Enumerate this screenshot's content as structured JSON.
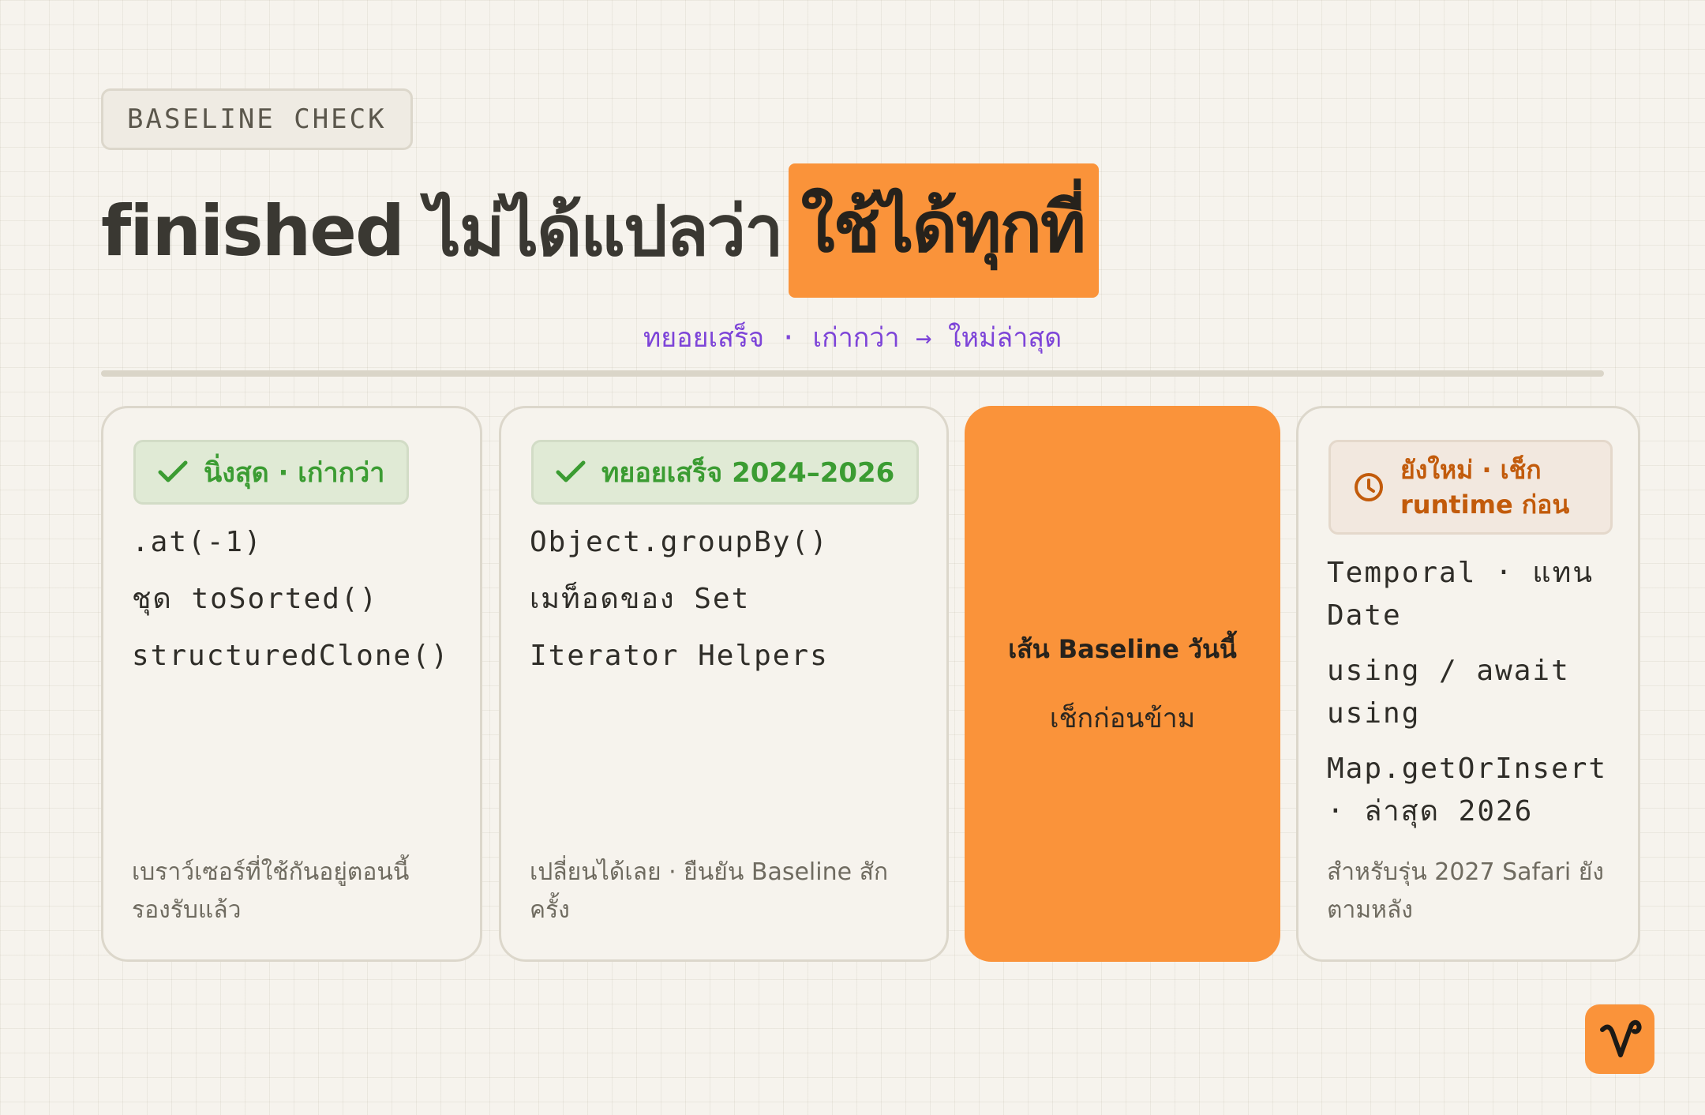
{
  "eyebrow": "BASELINE CHECK",
  "headline": {
    "main": "finished ไม่ได้แปลว่า",
    "highlight": "ใช้ได้ทุกที่"
  },
  "legend": "ทยอยเสร็จ · เก่ากว่า → ใหม่ล่าสุด",
  "colors": {
    "accent_orange": "#fa933a",
    "legend_purple": "#7d44d8",
    "ok_green": "#3b9c32",
    "warn_orange": "#c25b0b"
  },
  "cards": [
    {
      "badge_icon": "check-icon",
      "badge": "นิ่งสุด · เก่ากว่า",
      "items": [
        ".at(-1)",
        "ชุด toSorted()",
        "structuredClone()"
      ],
      "note": "เบราว์เซอร์ที่ใช้กันอยู่ตอนนี้รองรับแล้ว"
    },
    {
      "badge_icon": "check-icon",
      "badge": "ทยอยเสร็จ 2024–2026",
      "items": [
        "Object.groupBy()",
        "เมท็อดของ Set",
        "Iterator Helpers"
      ],
      "note": "เปลี่ยนได้เลย · ยืนยัน Baseline สักครั้ง"
    },
    {
      "title": "เส้น Baseline วันนี้",
      "subtitle": "เช็กก่อนข้าม"
    },
    {
      "badge_icon": "clock-icon",
      "badge": "ยังใหม่ · เช็ก runtime ก่อน",
      "items": [
        "Temporal · แทน Date",
        "using / await using",
        "Map.getOrInsert · ล่าสุด 2026"
      ],
      "note": "สำหรับรุ่น 2027 Safari ยังตามหลัง"
    }
  ],
  "logo_icon": "brand-logo-icon"
}
